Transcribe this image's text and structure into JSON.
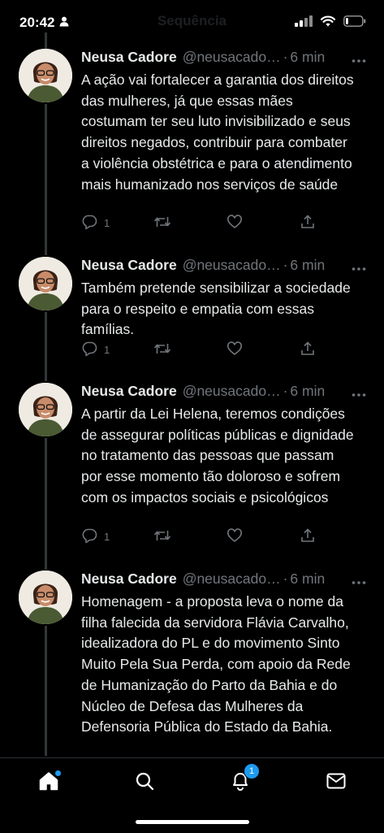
{
  "status_bar": {
    "time": "20:42",
    "person_icon": "person-icon",
    "signal_icon": "signal-bars-icon",
    "wifi_icon": "wifi-icon",
    "battery_icon": "battery-icon",
    "battery_level": 0.15
  },
  "header": {
    "title": "Sequência"
  },
  "tweets": [
    {
      "author": "Neusa Cadore",
      "handle": "@neusacado…",
      "separator": "·",
      "time": "6 min",
      "text": "A ação vai fortalecer a garantia dos direitos das mulheres, já que essas mães costumam ter seu luto invisibilizado e seus direitos negados, contribuir para combater a violência obstétrica e para o atendimento mais humanizado nos serviços de saúde",
      "reply_count": "1"
    },
    {
      "author": "Neusa Cadore",
      "handle": "@neusacado…",
      "separator": "·",
      "time": "6 min",
      "text": "Também pretende sensibilizar a sociedade para o respeito e empatia com essas famílias.",
      "reply_count": "1"
    },
    {
      "author": "Neusa Cadore",
      "handle": "@neusacado…",
      "separator": "·",
      "time": "6 min",
      "text": "A partir da Lei Helena, teremos condições de assegurar políticas públicas e dignidade no tratamento das pessoas que passam por esse momento tão doloroso e sofrem com os impactos sociais e psicológicos",
      "reply_count": "1"
    },
    {
      "author": "Neusa Cadore",
      "handle": "@neusacado…",
      "separator": "·",
      "time": "6 min",
      "text": "Homenagem - a proposta leva o nome da filha falecida da servidora Flávia Carvalho, idealizadora do PL e do movimento Sinto Muito Pela Sua Perda, com apoio da Rede de Humanização do Parto da Bahia e do Núcleo de Defesa das Mulheres da Defensoria Pública do Estado da Bahia."
    }
  ],
  "bottom_nav": {
    "items": [
      {
        "icon": "home-icon",
        "active": true
      },
      {
        "icon": "search-icon"
      },
      {
        "icon": "notifications-bell-icon",
        "badge": "1"
      },
      {
        "icon": "messages-envelope-icon"
      }
    ]
  },
  "colors": {
    "background": "#000000",
    "text": "#e7e9ea",
    "secondary": "#71767b",
    "accent": "#1d9bf0"
  }
}
